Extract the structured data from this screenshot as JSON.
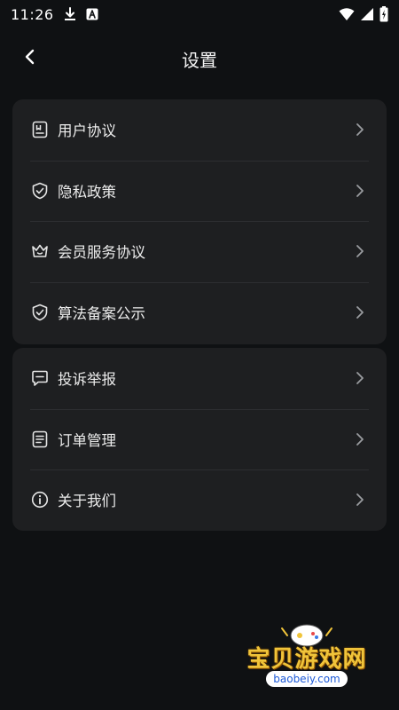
{
  "status_bar": {
    "time": "11:26",
    "icons": [
      "download-icon",
      "notification-a-icon",
      "wifi-icon",
      "signal-icon",
      "battery-charging-icon"
    ]
  },
  "header": {
    "title": "设置",
    "back_icon": "chevron-left-icon"
  },
  "groups": [
    {
      "items": [
        {
          "label": "用户协议",
          "icon": "document-icon"
        },
        {
          "label": "隐私政策",
          "icon": "shield-check-icon"
        },
        {
          "label": "会员服务协议",
          "icon": "crown-icon"
        },
        {
          "label": "算法备案公示",
          "icon": "shield-check-icon"
        }
      ]
    },
    {
      "items": [
        {
          "label": "投诉举报",
          "icon": "message-icon"
        },
        {
          "label": "订单管理",
          "icon": "list-icon"
        },
        {
          "label": "关于我们",
          "icon": "info-icon"
        }
      ]
    }
  ],
  "watermark": {
    "title": "宝贝游戏网",
    "url": "baobeiy.com"
  },
  "colors": {
    "background": "#0f1113",
    "card": "#1e1f21",
    "divider": "#2d2e31",
    "text": "#ececec",
    "chevron": "#9a9ca0"
  }
}
